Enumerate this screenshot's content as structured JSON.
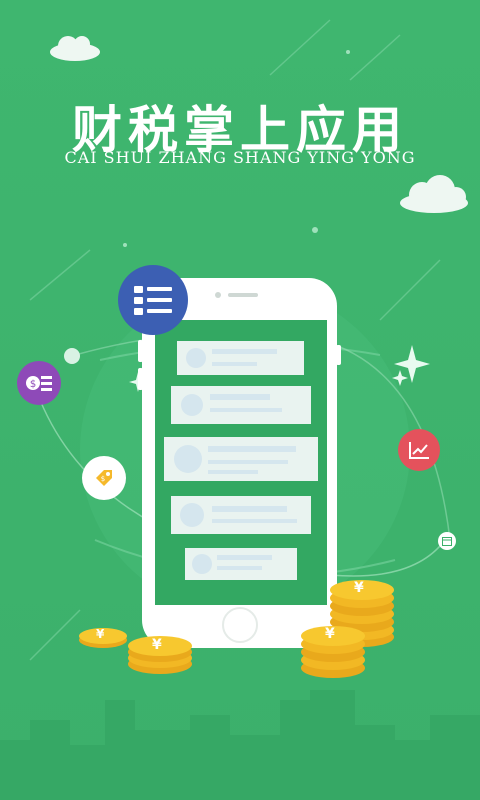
{
  "splash": {
    "title": "财税掌上应用",
    "subtitle": "CAI SHUI ZHANG SHANG YING YONG"
  },
  "icons": {
    "list": "list-icon",
    "money_card": "money-card-icon",
    "price_tag": "price-tag-icon",
    "chart": "line-chart-icon",
    "calendar": "calendar-icon",
    "yen": "yen-coin-icon"
  },
  "coins": {
    "symbol": "¥"
  },
  "colors": {
    "background": "#3cb371",
    "phone_screen": "#33a862",
    "list_button": "#3c5fb3",
    "money_button": "#8e4ab8",
    "chart_button": "#e4525c",
    "coin": "#f7c82f"
  }
}
